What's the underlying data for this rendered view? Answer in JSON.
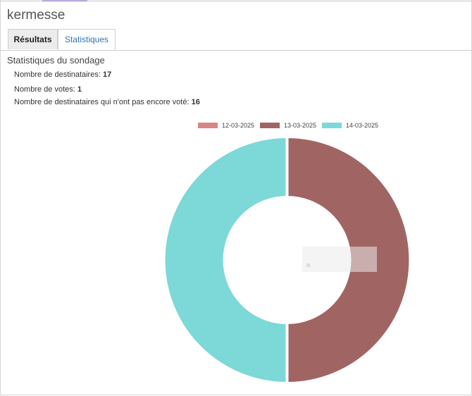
{
  "page": {
    "title": "kermesse"
  },
  "tabs": [
    {
      "label": "Résultats",
      "active": false
    },
    {
      "label": "Statistiques",
      "active": true
    }
  ],
  "stats": {
    "section_title": "Statistiques du sondage",
    "recipients_label": "Nombre de destinataires:",
    "recipients_value": "17",
    "votes_label": "Nombre de votes:",
    "votes_value": "1",
    "not_voted_label": "Nombre de destinataires qui n'ont pas encore voté:",
    "not_voted_value": "16"
  },
  "chart_data": {
    "type": "doughnut",
    "categories": [
      "12-03-2025",
      "13-03-2025",
      "14-03-2025"
    ],
    "values": [
      0,
      1,
      1
    ],
    "colors": [
      "#d98583",
      "#a06563",
      "#7dd8d8"
    ],
    "legend_position": "top"
  }
}
